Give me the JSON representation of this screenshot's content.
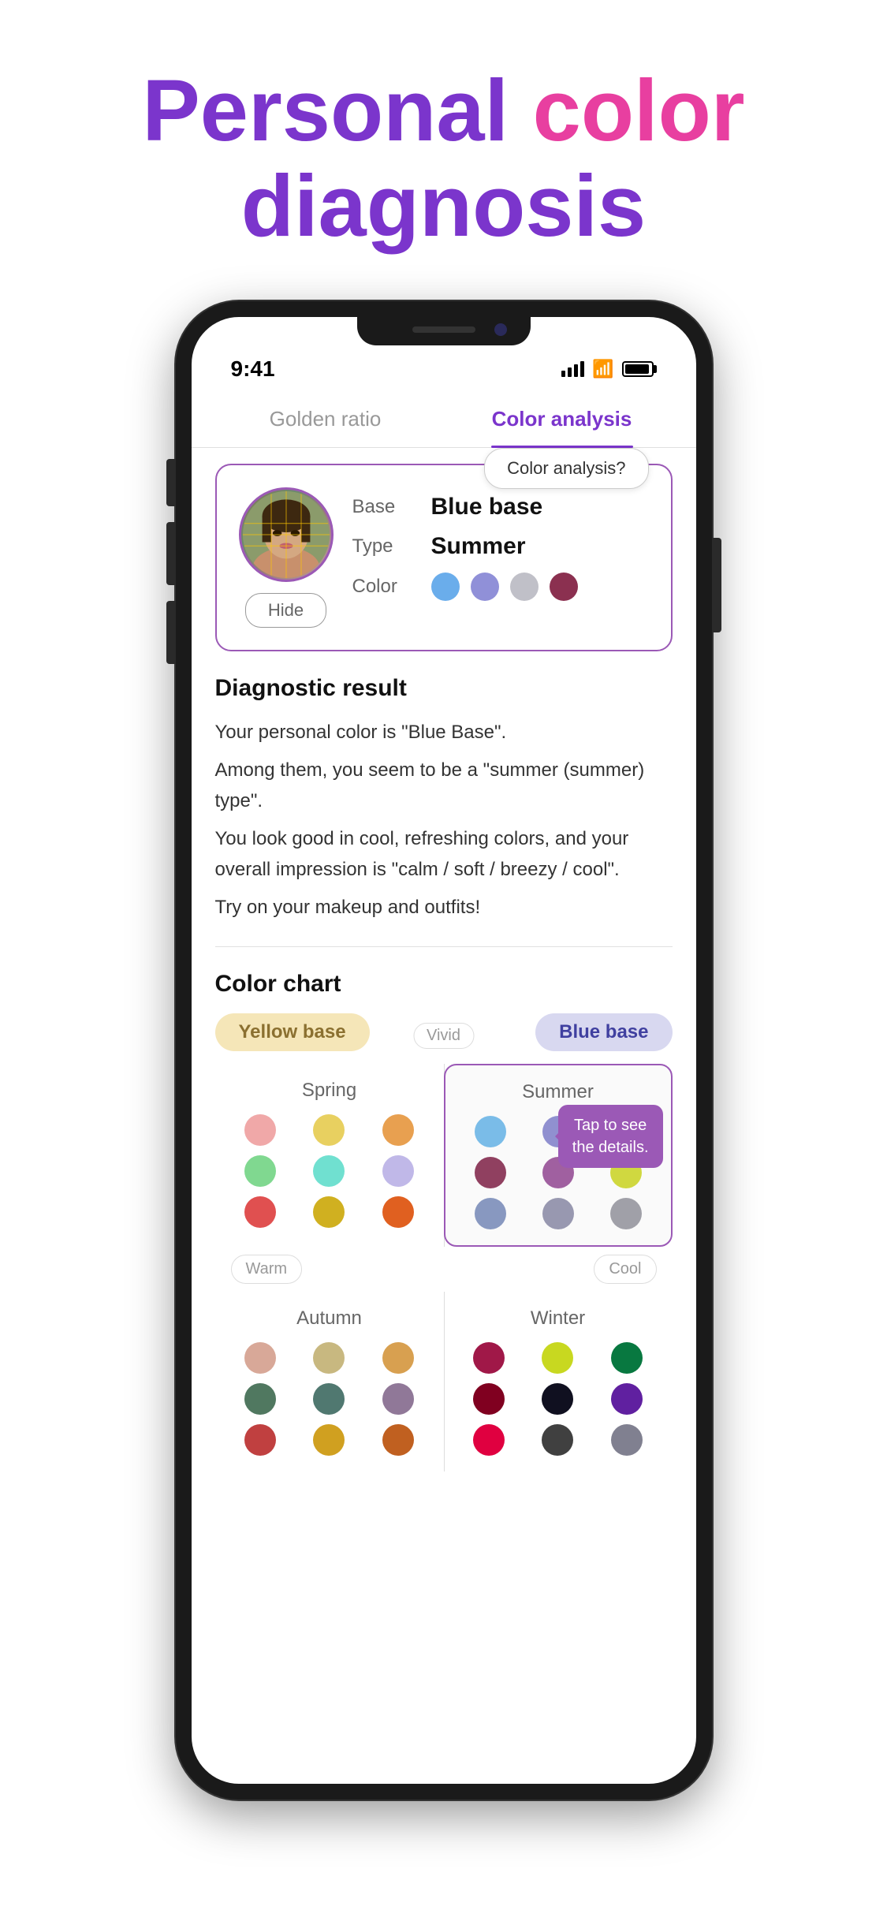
{
  "page": {
    "title_personal": "Personal",
    "title_color": " color",
    "title_diagnosis": "diagnosis"
  },
  "status_bar": {
    "time": "9:41",
    "signal_bars": 4,
    "battery_level": "full"
  },
  "tabs": {
    "tab1": {
      "label": "Golden ratio",
      "active": false
    },
    "tab2": {
      "label": "Color analysis",
      "active": true
    }
  },
  "result_card": {
    "base_label": "Base",
    "base_value": "Blue base",
    "type_label": "Type",
    "type_value": "Summer",
    "color_label": "Color",
    "hide_button": "Hide",
    "color_dots": [
      "#6AADEB",
      "#9090D8",
      "#C0C0C8",
      "#8B3050"
    ]
  },
  "color_analysis_button": "Color analysis?",
  "diagnostic": {
    "title": "Diagnostic result",
    "lines": [
      "Your personal color is \"Blue Base\".",
      "Among them, you seem to be a \"summer (summer) type\".",
      "You look good in cool, refreshing colors, and your overall impression is \"calm / soft / breezy / cool\".",
      "Try on your makeup and outfits!"
    ]
  },
  "color_chart": {
    "title": "Color chart",
    "yellow_base_label": "Yellow base",
    "blue_base_label": "Blue base",
    "vivid_label": "Vivid",
    "warm_label": "Warm",
    "cool_label": "Cool",
    "tap_tooltip": "Tap to see\nthe details.",
    "seasons": {
      "spring": {
        "name": "Spring",
        "colors": [
          "#F0A8A8",
          "#E8D060",
          "#E8A050",
          "#80D890",
          "#70E0D0",
          "#C0B8E8",
          "#E05050",
          "#D0B020",
          "#E06020"
        ]
      },
      "summer": {
        "name": "Summer",
        "highlighted": true,
        "colors": [
          "#7ABCE8",
          "#9090D0",
          "#B0B0C0",
          "#904060",
          "#A060A0",
          "#D0D840",
          "#8898C0",
          "#9898B0",
          "#A0A0A8"
        ]
      },
      "autumn": {
        "name": "Autumn",
        "colors": [
          "#D8A898",
          "#C8B880",
          "#D8A050",
          "#507860",
          "#507870",
          "#907898",
          "#C04040",
          "#D0A020",
          "#C06020"
        ]
      },
      "winter": {
        "name": "Winter",
        "colors": [
          "#A01848",
          "#C8D820",
          "#087840",
          "#800020",
          "#101020",
          "#6020A0",
          "#E00040",
          "#404040",
          "#808090"
        ]
      }
    }
  }
}
